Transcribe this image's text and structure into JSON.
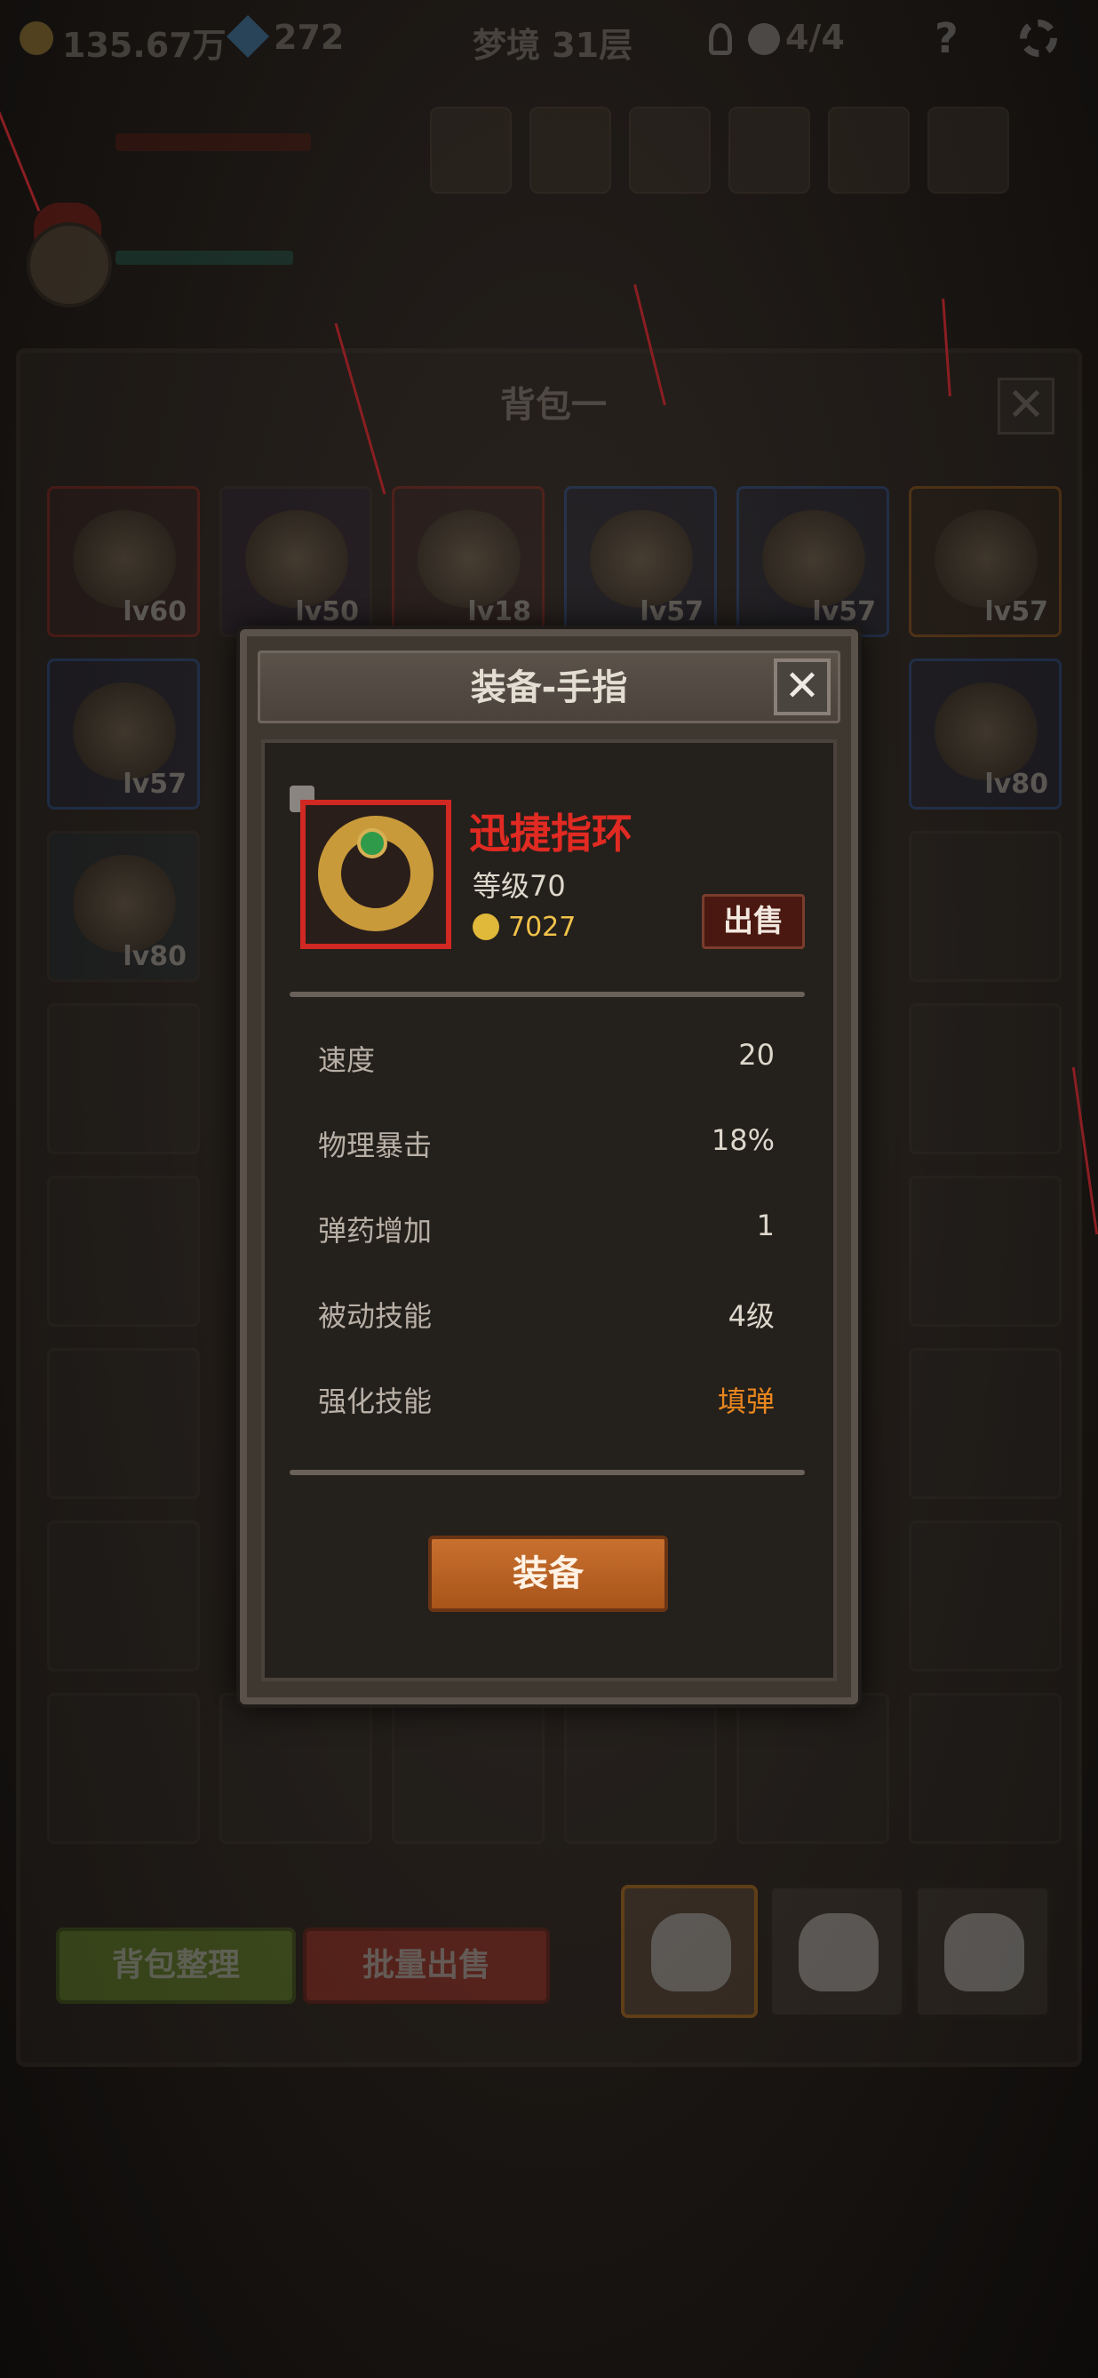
{
  "topbar": {
    "gold": "135.67万",
    "gems": "272",
    "stage": "梦境 31层",
    "keys_label": "4/4",
    "help": "?"
  },
  "bag": {
    "title": "背包一",
    "close_label": "✕",
    "sort_label": "背包整理",
    "bulk_sell_label": "批量出售",
    "items_row1": [
      {
        "level": "lv60",
        "rarity": "red",
        "icon": "bow-icon"
      },
      {
        "level": "lv50",
        "rarity": "none",
        "icon": "dagger-icon"
      },
      {
        "level": "lv18",
        "rarity": "red",
        "icon": "dagger-icon"
      },
      {
        "level": "lv57",
        "rarity": "blue",
        "icon": "orb-icon"
      },
      {
        "level": "lv57",
        "rarity": "blue",
        "icon": "shield-icon"
      },
      {
        "level": "lv57",
        "rarity": "orange",
        "icon": "horn-icon"
      }
    ],
    "items_row2": [
      {
        "level": "lv57",
        "rarity": "blue",
        "icon": "horn-icon"
      },
      {
        "level": "lv80",
        "rarity": "blue",
        "icon": "armor-icon"
      }
    ],
    "items_row3": [
      {
        "level": "lv80",
        "rarity": "none",
        "icon": "crossbow-icon"
      }
    ]
  },
  "modal": {
    "title": "装备-手指",
    "close_label": "✕",
    "item": {
      "name": "迅捷指环",
      "level": "等级70",
      "price": "7027",
      "icon": "ring-icon",
      "locked_icon": "lock-icon"
    },
    "sell_label": "出售",
    "stats": [
      {
        "label": "速度",
        "value": "20"
      },
      {
        "label": "物理暴击",
        "value": "18%"
      },
      {
        "label": "弹药增加",
        "value": "1"
      },
      {
        "label": "被动技能",
        "value": "4级"
      },
      {
        "label": "强化技能",
        "value": "填弹"
      }
    ],
    "equip_label": "装备"
  },
  "colors": {
    "item_name": "#e02a22",
    "price": "#f0c24a",
    "equip_button": "#c8702e",
    "sort_button": "#7aa42e",
    "bulk_sell_button": "#c43a2c",
    "highlight_stat": "#e8861e"
  }
}
